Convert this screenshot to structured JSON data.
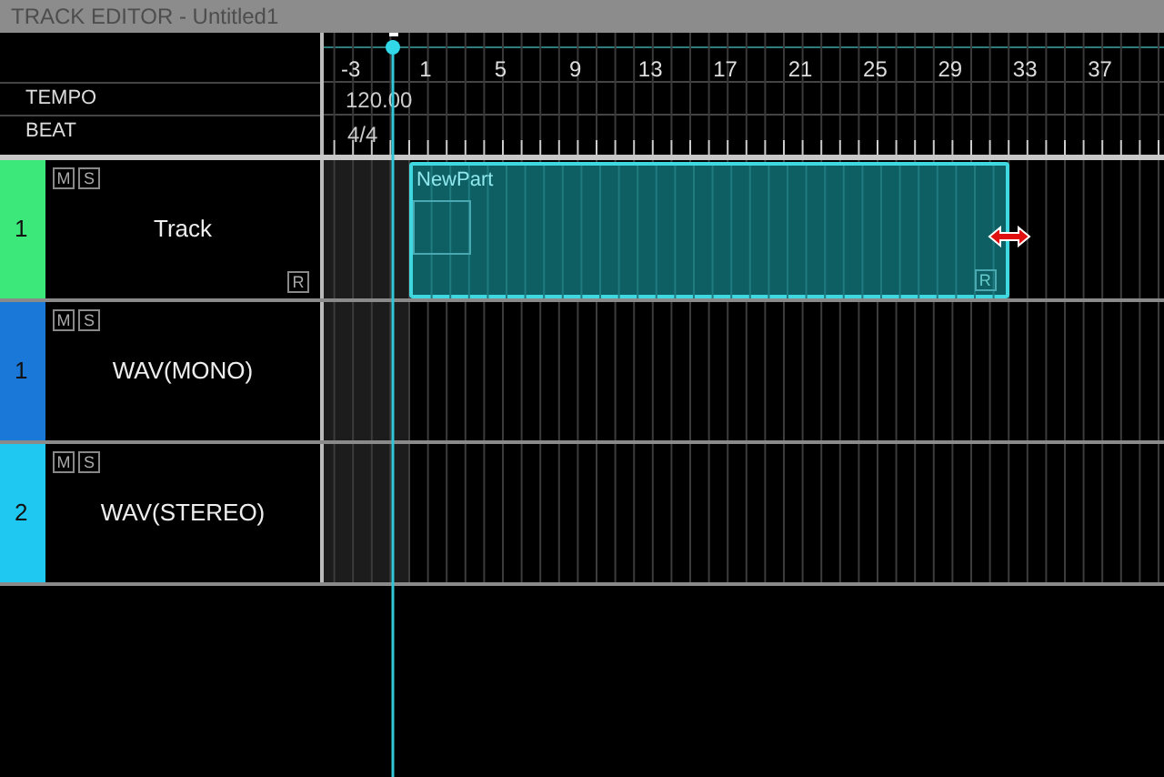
{
  "window": {
    "title": "TRACK EDITOR - Untitled1"
  },
  "ruler": {
    "bar_labels": [
      "-3",
      "1",
      "5",
      "9",
      "13",
      "17",
      "21",
      "25",
      "29",
      "33",
      "37"
    ],
    "tempo_label": "TEMPO",
    "tempo_value": "120.00",
    "beat_label": "BEAT",
    "beat_value": "4/4"
  },
  "tracks": [
    {
      "number": "1",
      "name": "Track",
      "color": "#3de87a",
      "mute_label": "M",
      "solo_label": "S",
      "record_label": "R",
      "parts": [
        {
          "name": "NewPart",
          "record_label": "R",
          "selected": true
        }
      ]
    },
    {
      "number": "1",
      "name": "WAV(MONO)",
      "color": "#1a78d8",
      "mute_label": "M",
      "solo_label": "S"
    },
    {
      "number": "2",
      "name": "WAV(STEREO)",
      "color": "#1ec8f0",
      "mute_label": "M",
      "solo_label": "S"
    }
  ]
}
